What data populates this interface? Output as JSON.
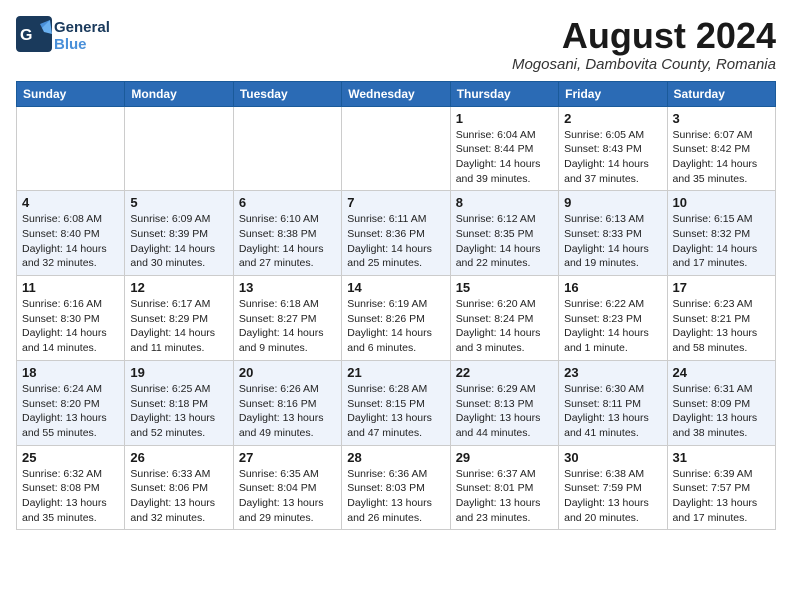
{
  "header": {
    "logo_general": "General",
    "logo_blue": "Blue",
    "month_title": "August 2024",
    "location": "Mogosani, Dambovita County, Romania"
  },
  "weekdays": [
    "Sunday",
    "Monday",
    "Tuesday",
    "Wednesday",
    "Thursday",
    "Friday",
    "Saturday"
  ],
  "weeks": [
    [
      {
        "day": "",
        "info": ""
      },
      {
        "day": "",
        "info": ""
      },
      {
        "day": "",
        "info": ""
      },
      {
        "day": "",
        "info": ""
      },
      {
        "day": "1",
        "info": "Sunrise: 6:04 AM\nSunset: 8:44 PM\nDaylight: 14 hours\nand 39 minutes."
      },
      {
        "day": "2",
        "info": "Sunrise: 6:05 AM\nSunset: 8:43 PM\nDaylight: 14 hours\nand 37 minutes."
      },
      {
        "day": "3",
        "info": "Sunrise: 6:07 AM\nSunset: 8:42 PM\nDaylight: 14 hours\nand 35 minutes."
      }
    ],
    [
      {
        "day": "4",
        "info": "Sunrise: 6:08 AM\nSunset: 8:40 PM\nDaylight: 14 hours\nand 32 minutes."
      },
      {
        "day": "5",
        "info": "Sunrise: 6:09 AM\nSunset: 8:39 PM\nDaylight: 14 hours\nand 30 minutes."
      },
      {
        "day": "6",
        "info": "Sunrise: 6:10 AM\nSunset: 8:38 PM\nDaylight: 14 hours\nand 27 minutes."
      },
      {
        "day": "7",
        "info": "Sunrise: 6:11 AM\nSunset: 8:36 PM\nDaylight: 14 hours\nand 25 minutes."
      },
      {
        "day": "8",
        "info": "Sunrise: 6:12 AM\nSunset: 8:35 PM\nDaylight: 14 hours\nand 22 minutes."
      },
      {
        "day": "9",
        "info": "Sunrise: 6:13 AM\nSunset: 8:33 PM\nDaylight: 14 hours\nand 19 minutes."
      },
      {
        "day": "10",
        "info": "Sunrise: 6:15 AM\nSunset: 8:32 PM\nDaylight: 14 hours\nand 17 minutes."
      }
    ],
    [
      {
        "day": "11",
        "info": "Sunrise: 6:16 AM\nSunset: 8:30 PM\nDaylight: 14 hours\nand 14 minutes."
      },
      {
        "day": "12",
        "info": "Sunrise: 6:17 AM\nSunset: 8:29 PM\nDaylight: 14 hours\nand 11 minutes."
      },
      {
        "day": "13",
        "info": "Sunrise: 6:18 AM\nSunset: 8:27 PM\nDaylight: 14 hours\nand 9 minutes."
      },
      {
        "day": "14",
        "info": "Sunrise: 6:19 AM\nSunset: 8:26 PM\nDaylight: 14 hours\nand 6 minutes."
      },
      {
        "day": "15",
        "info": "Sunrise: 6:20 AM\nSunset: 8:24 PM\nDaylight: 14 hours\nand 3 minutes."
      },
      {
        "day": "16",
        "info": "Sunrise: 6:22 AM\nSunset: 8:23 PM\nDaylight: 14 hours\nand 1 minute."
      },
      {
        "day": "17",
        "info": "Sunrise: 6:23 AM\nSunset: 8:21 PM\nDaylight: 13 hours\nand 58 minutes."
      }
    ],
    [
      {
        "day": "18",
        "info": "Sunrise: 6:24 AM\nSunset: 8:20 PM\nDaylight: 13 hours\nand 55 minutes."
      },
      {
        "day": "19",
        "info": "Sunrise: 6:25 AM\nSunset: 8:18 PM\nDaylight: 13 hours\nand 52 minutes."
      },
      {
        "day": "20",
        "info": "Sunrise: 6:26 AM\nSunset: 8:16 PM\nDaylight: 13 hours\nand 49 minutes."
      },
      {
        "day": "21",
        "info": "Sunrise: 6:28 AM\nSunset: 8:15 PM\nDaylight: 13 hours\nand 47 minutes."
      },
      {
        "day": "22",
        "info": "Sunrise: 6:29 AM\nSunset: 8:13 PM\nDaylight: 13 hours\nand 44 minutes."
      },
      {
        "day": "23",
        "info": "Sunrise: 6:30 AM\nSunset: 8:11 PM\nDaylight: 13 hours\nand 41 minutes."
      },
      {
        "day": "24",
        "info": "Sunrise: 6:31 AM\nSunset: 8:09 PM\nDaylight: 13 hours\nand 38 minutes."
      }
    ],
    [
      {
        "day": "25",
        "info": "Sunrise: 6:32 AM\nSunset: 8:08 PM\nDaylight: 13 hours\nand 35 minutes."
      },
      {
        "day": "26",
        "info": "Sunrise: 6:33 AM\nSunset: 8:06 PM\nDaylight: 13 hours\nand 32 minutes."
      },
      {
        "day": "27",
        "info": "Sunrise: 6:35 AM\nSunset: 8:04 PM\nDaylight: 13 hours\nand 29 minutes."
      },
      {
        "day": "28",
        "info": "Sunrise: 6:36 AM\nSunset: 8:03 PM\nDaylight: 13 hours\nand 26 minutes."
      },
      {
        "day": "29",
        "info": "Sunrise: 6:37 AM\nSunset: 8:01 PM\nDaylight: 13 hours\nand 23 minutes."
      },
      {
        "day": "30",
        "info": "Sunrise: 6:38 AM\nSunset: 7:59 PM\nDaylight: 13 hours\nand 20 minutes."
      },
      {
        "day": "31",
        "info": "Sunrise: 6:39 AM\nSunset: 7:57 PM\nDaylight: 13 hours\nand 17 minutes."
      }
    ]
  ]
}
